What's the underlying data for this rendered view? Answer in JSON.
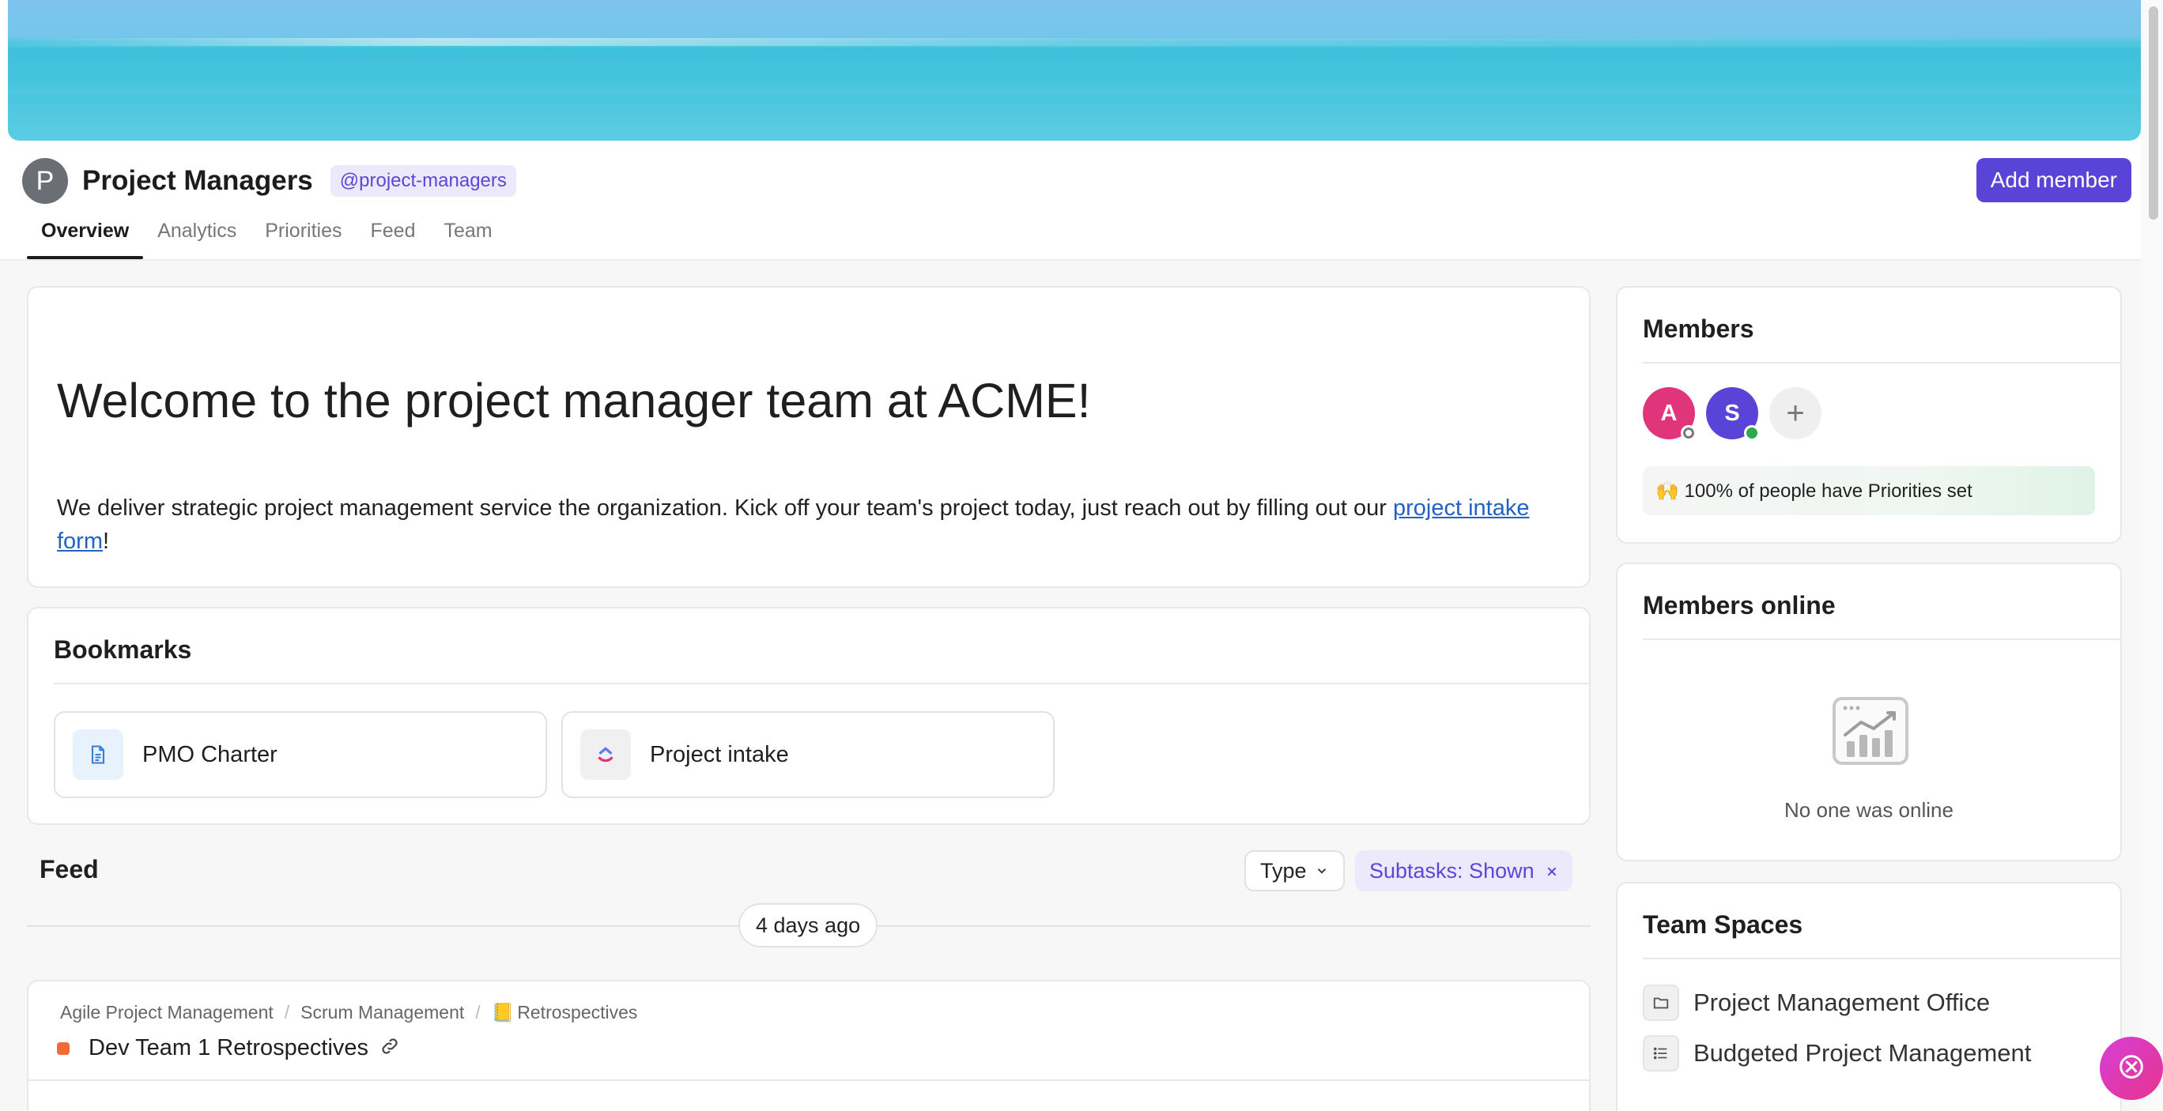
{
  "team": {
    "avatar_letter": "P",
    "name": "Project Managers",
    "handle": "@project-managers",
    "add_member_label": "Add member"
  },
  "tabs": [
    {
      "label": "Overview",
      "active": true
    },
    {
      "label": "Analytics",
      "active": false
    },
    {
      "label": "Priorities",
      "active": false
    },
    {
      "label": "Feed",
      "active": false
    },
    {
      "label": "Team",
      "active": false
    }
  ],
  "welcome": {
    "heading": "Welcome to the project manager team at ACME!",
    "body_before": "We deliver strategic project management service the organization. Kick off your team's project today, just reach out by filling out our ",
    "link_text": "project intake form",
    "body_after": "!"
  },
  "bookmarks": {
    "title": "Bookmarks",
    "items": [
      {
        "label": "PMO Charter",
        "icon": "document-icon"
      },
      {
        "label": "Project intake",
        "icon": "clickup-logo-icon"
      }
    ]
  },
  "feed": {
    "title": "Feed",
    "type_filter": "Type",
    "subtasks_filter": "Subtasks: Shown",
    "date_divider": "4 days ago",
    "item": {
      "breadcrumbs": [
        "Agile Project Management",
        "Scrum Management",
        "Retrospectives"
      ],
      "breadcrumb_emoji": "📒",
      "task_name": "Dev Team 1 Retrospectives",
      "task_color": "#f06a3a"
    }
  },
  "members": {
    "title": "Members",
    "avatars": [
      {
        "letter": "A",
        "color": "#e0357a",
        "status": "offline"
      },
      {
        "letter": "S",
        "color": "#5a44d8",
        "status": "online"
      }
    ],
    "priorities_text": "🙌 100% of people have Priorities set"
  },
  "members_online": {
    "title": "Members online",
    "empty_text": "No one was online"
  },
  "team_spaces": {
    "title": "Team Spaces",
    "items": [
      {
        "label": "Project Management Office",
        "icon": "folder-icon"
      },
      {
        "label": "Budgeted Project Management",
        "icon": "list-icon"
      }
    ]
  },
  "colors": {
    "accent": "#5a44d8",
    "link": "#2361c2",
    "online": "#2fa84f",
    "fab": "#d63fd8"
  }
}
